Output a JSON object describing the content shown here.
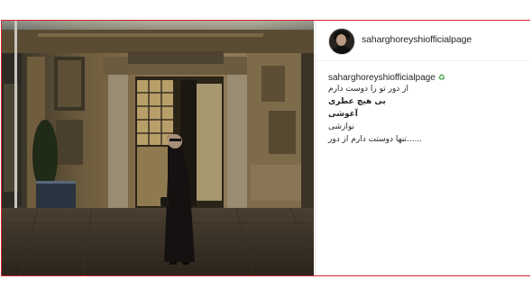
{
  "post": {
    "username": "saharghoreyshiofficialpage",
    "caption_username": "saharghoreyshiofficialpage",
    "caption_emoji": "♻",
    "caption_lines": [
      "از دور تو را دوست دارم",
      "بی هیچ عطری",
      "آغوشی",
      "نوازشی",
      "......تنها دوستت دارم از دور"
    ]
  },
  "photo": {
    "description_icon": "photo-of-woman-in-doorway"
  },
  "colors": {
    "frame_border": "#d8262c",
    "text": "#262626"
  }
}
